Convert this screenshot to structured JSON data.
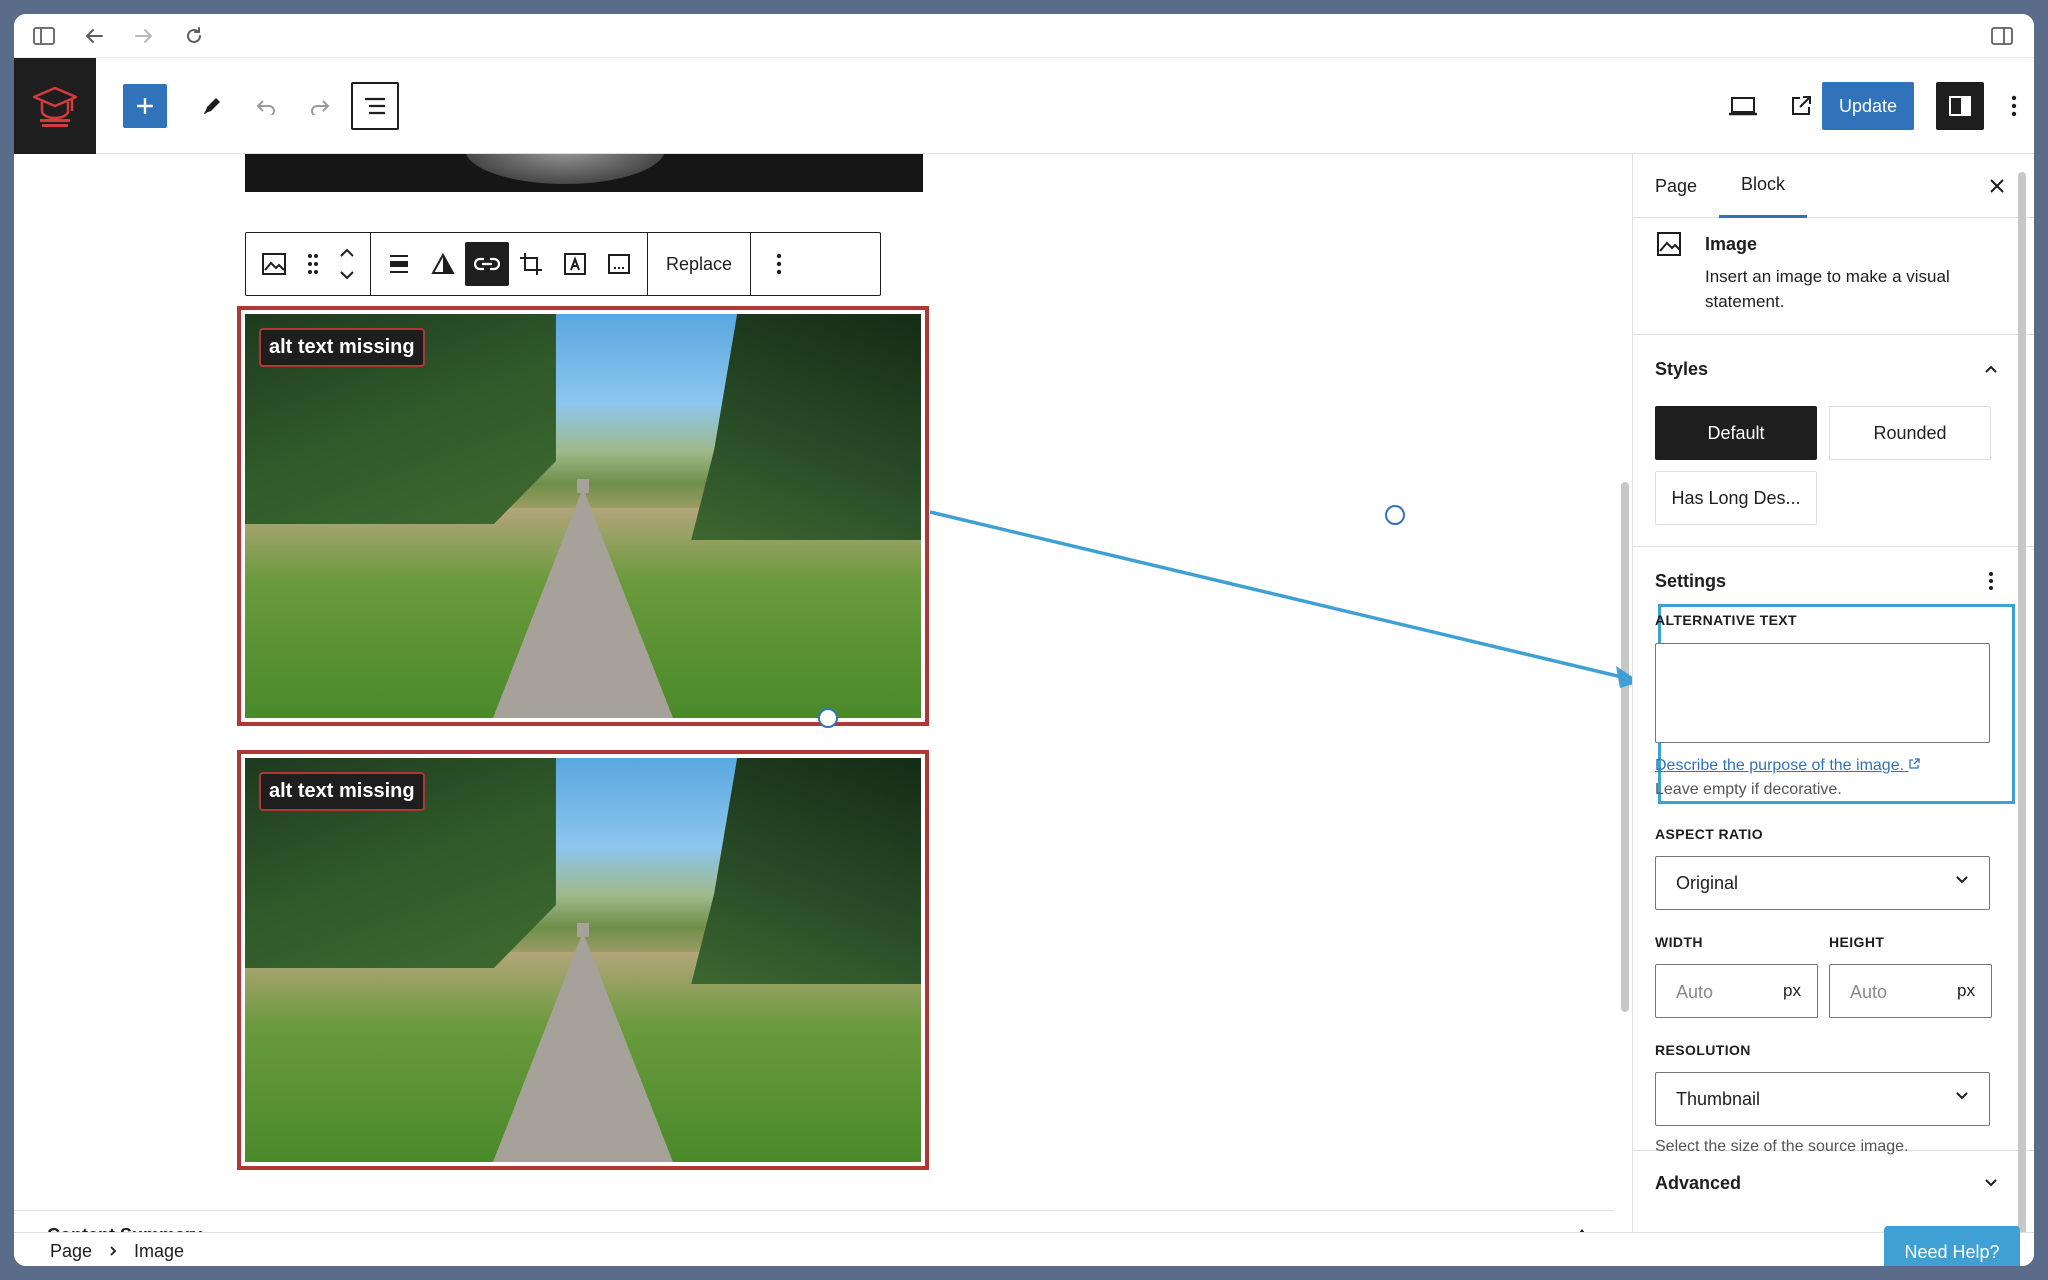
{
  "header": {
    "update_label": "Update"
  },
  "toolbar": {
    "replace_label": "Replace"
  },
  "canvas": {
    "badge_1": "alt text missing",
    "badge_2": "alt text missing",
    "content_summary": "Content Summary"
  },
  "sidebar": {
    "tabs": [
      {
        "label": "Page"
      },
      {
        "label": "Block"
      }
    ],
    "block": {
      "title": "Image",
      "description": "Insert an image to make a visual statement."
    },
    "styles": {
      "title": "Styles",
      "options": [
        "Default",
        "Rounded",
        "Has Long Des..."
      ]
    },
    "settings": {
      "title": "Settings",
      "alt_text_label": "ALTERNATIVE TEXT",
      "alt_text_value": "",
      "alt_help_link": "Describe the purpose of the image.",
      "alt_help_note": "Leave empty if decorative.",
      "aspect_ratio_label": "ASPECT RATIO",
      "aspect_ratio_value": "Original",
      "width_label": "WIDTH",
      "width_placeholder": "Auto",
      "width_unit": "px",
      "height_label": "HEIGHT",
      "height_placeholder": "Auto",
      "height_unit": "px",
      "resolution_label": "RESOLUTION",
      "resolution_value": "Thumbnail",
      "resolution_note": "Select the size of the source image."
    },
    "advanced": {
      "title": "Advanced"
    }
  },
  "breadcrumb": [
    "Page",
    "Image"
  ],
  "need_help": "Need Help?",
  "colors": {
    "accent": "#3173ba",
    "error_outline": "#b13737",
    "focus": "#3fa0d4"
  }
}
